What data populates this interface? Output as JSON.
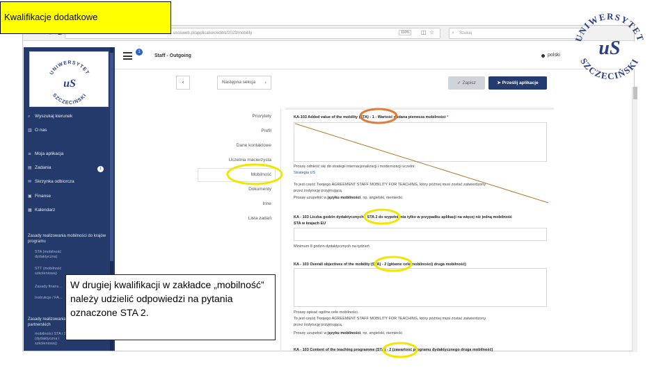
{
  "slide": {
    "title": "Kwalifikacje dodatkowe",
    "callout_text": "W drugiej kwalifikacji w zakładce „mobilność” należy udzielić odpowiedzi na pytania oznaczone STA 2.",
    "highlight_color": "#ffff00",
    "annotation_colors": {
      "yellow_ellipse": "#f2e600",
      "orange_ellipse": "#e07b39",
      "line": "#b3782a"
    }
  },
  "browser": {
    "url": "...usosweb.pl/application/edit/s/2023/mobility",
    "zoom": "110%",
    "search_placeholder": "Szukaj",
    "nav_icons": [
      "back-arrow-icon",
      "forward-arrow-icon",
      "reload-icon",
      "home-icon"
    ],
    "toolbar_icons": [
      "bookmark-star-icon",
      "pocket-icon",
      "download-icon"
    ]
  },
  "app": {
    "header_title": "Staff - Outgoing",
    "notification_count": "1",
    "language": "polski"
  },
  "sidebar": {
    "items": [
      {
        "icon": "search-icon",
        "label": "Wyszukaj kierunek"
      },
      {
        "icon": "bank-icon",
        "label": "O nas"
      },
      {
        "icon": "list-icon",
        "label": "Moja aplikacja"
      },
      {
        "icon": "inbox-icon",
        "label": "Zadania",
        "badge": "1"
      },
      {
        "icon": "mailbox-icon",
        "label": "Skrzynka odbiorcza"
      },
      {
        "icon": "money-icon",
        "label": "Finanse"
      },
      {
        "icon": "calendar-icon",
        "label": "Kalendarz"
      }
    ],
    "section1_title": "Zasady realizowania mobilności do krajów programu",
    "section1_links": [
      "STA (mobilność dydaktyczna)",
      "STT (mobilność szkoleniowa)",
      "Zasady finans...",
      "Instrukcje / FA..."
    ],
    "section2_title": "Zasady realizowania mobilności do krajów partnerskich",
    "section2_links": [
      "mobilności STA i STT (dydaktyczna i szkoleniowa)"
    ]
  },
  "toolbar": {
    "back_icon": "chevron-left-icon",
    "next_label": "Następna sekcja",
    "save_label": "Zapisz",
    "submit_label": "Prześlij aplikacje"
  },
  "tabs": [
    "Priorytety",
    "Profil",
    "Dane kontaktowe",
    "Uczelnia macierzysta",
    "Mobilność",
    "Dokumenty",
    "Inne",
    "Lista zadań"
  ],
  "active_tab": "Mobilność",
  "form": {
    "q1_label": "KA-103 Added value of the mobility (STA) - 1 - Wartość dodana pierwsza mobilności",
    "q1_required": "*",
    "q1_help1": "Proszę odnieść się do strategii internacjonalizacji i modernizacji uczelni:",
    "q1_help1_link": "Strategia US",
    "q1_help2": "To jest część Twojego AGREEMENT STAFF MOBILITY FOR TEACHING, który później musi zostać zatwierdzony",
    "q1_help3": "przez instytucję przyjmującą.",
    "q1_help4_pre": "Proszę uzupełnić w ",
    "q1_help4_bold": "języku mobilności",
    "q1_help4_post": ", np. angielski, niemiecki",
    "q2_label_line1": "KA - 103 Liczba godzin dydaktycznych - STA 2 do wypełnienia tylko w przypadku aplikacji na więcej niż jedną mobilność",
    "q2_label_line2": "STA w krajach EU",
    "q2_help": "Minimum 8 godzin dydaktycznych na tydzień",
    "q3_label": "KA - 103 Overall objectives of the mobility (STA) - 2 (główne cele mobilności) druga mobilność)",
    "q3_help1": "Proszę opisać ogólne cele mobilności.",
    "q3_help2": "To jest część Twojego AGREEMENT STAFF MOBILITY FOR TEACHING, który później musi zostać zatwierdzony",
    "q3_help3": "przez instytucję przyjmującą.",
    "q3_help4_pre": "Proszę uzupełnić w ",
    "q3_help4_bold": "języku mobilności",
    "q3_help4_post": ", np. angielski, niemiecki",
    "q4_label": "KA - 103 Content of the teaching programme (STA) - 2 (zawartość programu dydaktycznego druga mobilność)"
  },
  "logo": {
    "arc_top": "UNIWERSYTET",
    "arc_bottom": "SZCZECIŃSKI",
    "monogram": "uS"
  }
}
